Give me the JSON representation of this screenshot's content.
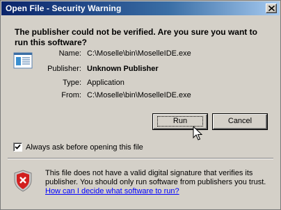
{
  "window": {
    "title": "Open File - Security Warning"
  },
  "heading": "The publisher could not be verified.  Are you sure you want to run this software?",
  "fields": {
    "name": {
      "label": "Name:",
      "value": "C:\\Moselle\\bin\\MoselleIDE.exe"
    },
    "publisher": {
      "label": "Publisher:",
      "value": "Unknown Publisher"
    },
    "type": {
      "label": "Type:",
      "value": "Application"
    },
    "from": {
      "label": "From:",
      "value": "C:\\Moselle\\bin\\MoselleIDE.exe"
    }
  },
  "buttons": {
    "run": "Run",
    "cancel": "Cancel"
  },
  "checkbox": {
    "label": "Always ask before opening this file",
    "checked": true
  },
  "warning": {
    "text": "This file does not have a valid digital signature that verifies its publisher.  You should only run software from publishers you trust.",
    "link": "How can I decide what software to run?"
  },
  "icons": {
    "close": "close-icon",
    "file": "executable-file-icon",
    "shield": "security-shield-error-icon",
    "cursor": "mouse-pointer-icon"
  }
}
